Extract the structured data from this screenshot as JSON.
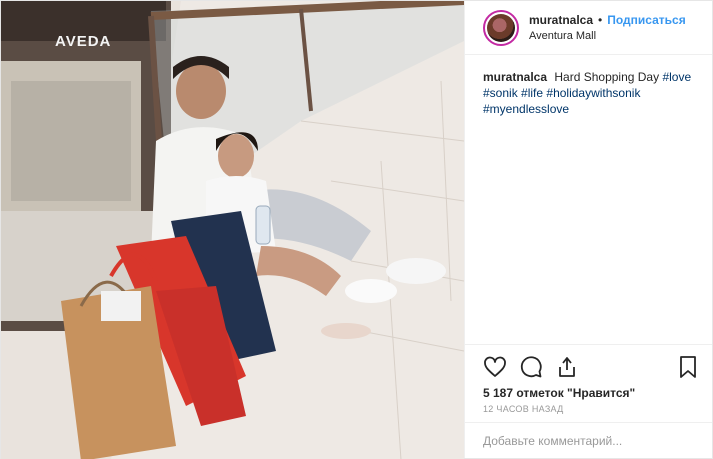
{
  "photo": {
    "store_sign": "AVEDA",
    "icon": "photo"
  },
  "header": {
    "username": "muratnalca",
    "separator": "•",
    "follow_label": "Подписаться",
    "location": "Aventura Mall"
  },
  "caption": {
    "username": "muratnalca",
    "text": "Hard Shopping Day",
    "hashtags": [
      "#love",
      "#sonik",
      "#life",
      "#holidaywithsonik",
      "#myendlesslove"
    ]
  },
  "actions": {
    "like_icon": "heart-icon",
    "comment_icon": "comment-icon",
    "share_icon": "share-icon",
    "save_icon": "bookmark-icon"
  },
  "likes_text": "5 187 отметок \"Нравится\"",
  "time_text": "12 часов назад",
  "comment": {
    "placeholder": "Добавьте комментарий..."
  },
  "colors": {
    "link": "#003569",
    "follow": "#3897f0",
    "accent_story_ring": "#c32aa3"
  }
}
